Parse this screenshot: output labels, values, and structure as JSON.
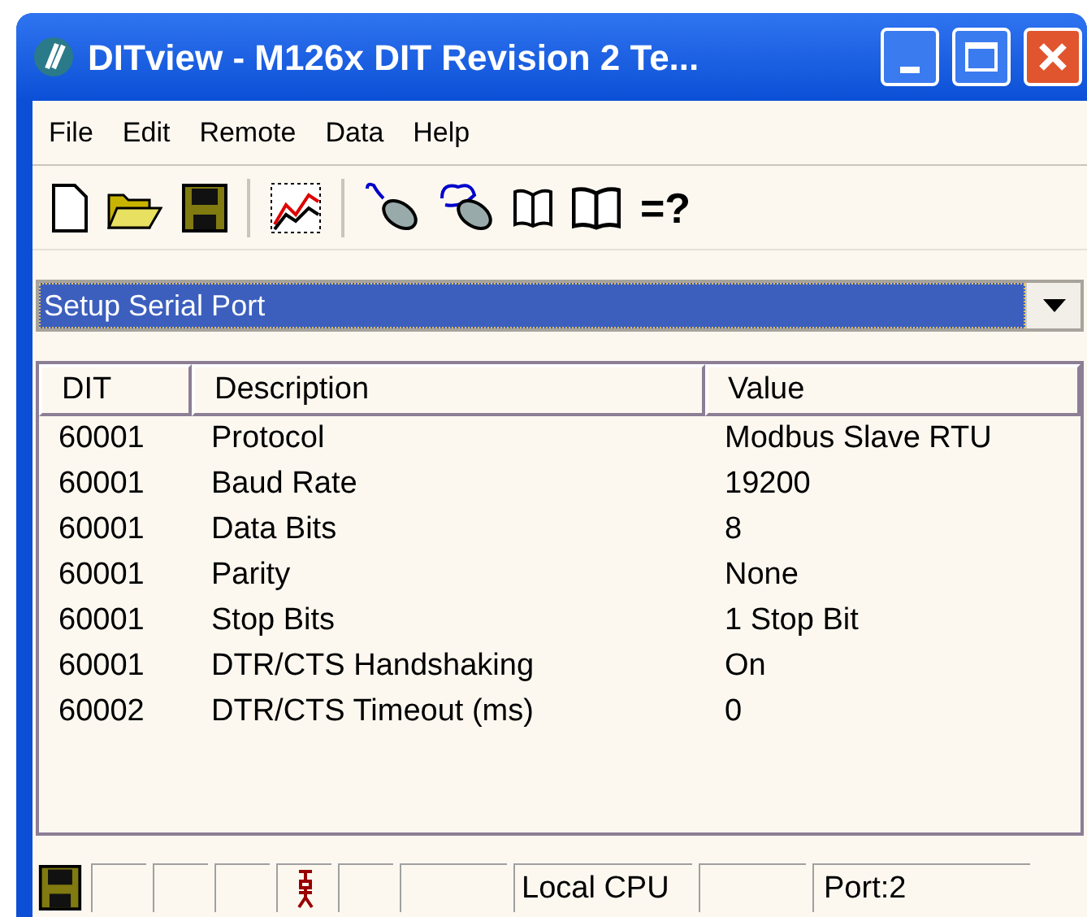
{
  "window": {
    "title": "DITview - M126x DIT Revision 2 Te..."
  },
  "menu": [
    "File",
    "Edit",
    "Remote",
    "Data",
    "Help"
  ],
  "toolbar": {
    "help_label": "=?"
  },
  "selector": {
    "value": "Setup Serial Port"
  },
  "table": {
    "columns": [
      "DIT",
      "Description",
      "Value"
    ],
    "rows": [
      {
        "dit": "60001",
        "description": "Protocol",
        "value": "Modbus Slave RTU"
      },
      {
        "dit": "60001",
        "description": "Baud Rate",
        "value": "19200"
      },
      {
        "dit": "60001",
        "description": "Data Bits",
        "value": "8"
      },
      {
        "dit": "60001",
        "description": "Parity",
        "value": "None"
      },
      {
        "dit": "60001",
        "description": "Stop Bits",
        "value": "1 Stop Bit"
      },
      {
        "dit": "60001",
        "description": "DTR/CTS Handshaking",
        "value": "On"
      },
      {
        "dit": "60002",
        "description": "DTR/CTS Timeout (ms)",
        "value": "0"
      }
    ]
  },
  "status_bar": {
    "source": "Local CPU",
    "port": "Port:2"
  }
}
